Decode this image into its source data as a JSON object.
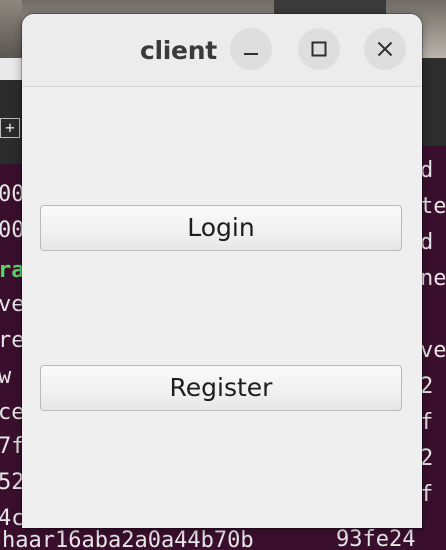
{
  "window": {
    "title": "client",
    "controls": {
      "minimize_icon": "minimize-icon",
      "maximize_icon": "maximize-icon",
      "close_icon": "close-icon"
    }
  },
  "buttons": {
    "login_label": "Login",
    "register_label": "Register"
  },
  "background_terminal": {
    "tab_button": "+",
    "left_fragments": [
      "00",
      "00",
      "ra",
      "ve",
      "re",
      "w",
      "ce",
      "7f",
      "52",
      "4c"
    ],
    "right_fragments": [
      "d",
      "te",
      "d",
      "ne",
      "ve",
      "2",
      "f",
      "2",
      "f"
    ],
    "bottom_left": "haar16aba2a0a44b70b",
    "bottom_right": "93fe24"
  },
  "colors": {
    "window_background": "#efefef",
    "terminal_background": "#3a0f2e",
    "terminal_green": "#59d66d"
  }
}
